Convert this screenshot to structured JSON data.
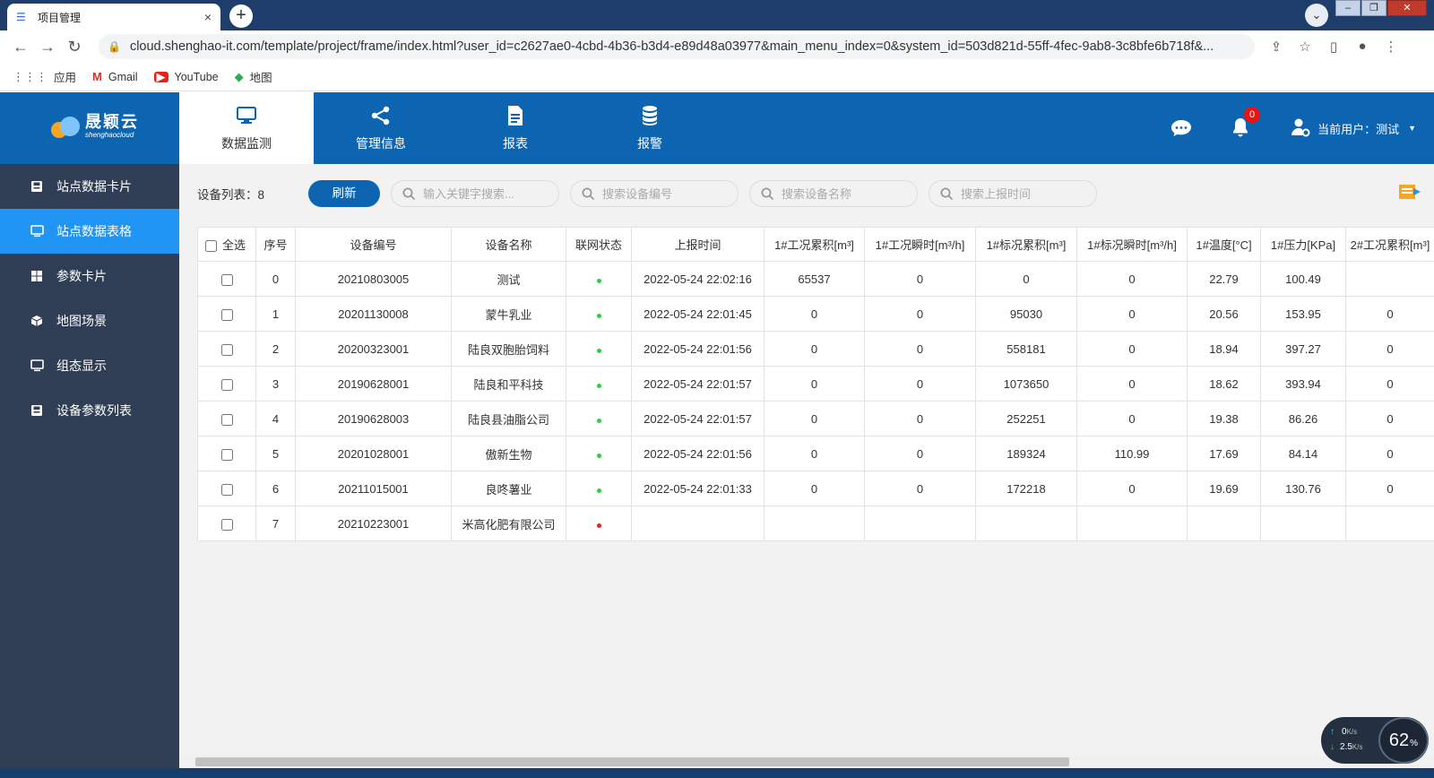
{
  "browser": {
    "tab_title": "项目管理",
    "tab_close": "×",
    "new_tab": "+",
    "url": "cloud.shenghao-it.com/template/project/frame/index.html?user_id=c2627ae0-4cbd-4b36-b3d4-e89d48a03977&main_menu_index=0&system_id=503d821d-55ff-4fec-9ab8-3c8bfe6b718f&...",
    "bookmarks": [
      {
        "label": "应用",
        "icon": "apps-grid-icon"
      },
      {
        "label": "Gmail",
        "icon": "gmail-icon"
      },
      {
        "label": "YouTube",
        "icon": "youtube-icon"
      },
      {
        "label": "地图",
        "icon": "maps-icon"
      }
    ]
  },
  "header": {
    "logo_text": "晟颖云",
    "logo_sub": "shenghaocloud",
    "nav": [
      {
        "label": "数据监测",
        "icon": "monitor-icon",
        "active": true
      },
      {
        "label": "管理信息",
        "icon": "share-nodes-icon",
        "active": false
      },
      {
        "label": "报表",
        "icon": "document-icon",
        "active": false
      },
      {
        "label": "报警",
        "icon": "database-icon",
        "active": false
      }
    ],
    "notification_count": "0",
    "current_user": "当前用户：测试"
  },
  "sidebar": {
    "items": [
      {
        "label": "站点数据卡片",
        "icon": "save-disk-icon",
        "active": false
      },
      {
        "label": "站点数据表格",
        "icon": "monitor-icon",
        "active": true
      },
      {
        "label": "参数卡片",
        "icon": "grid-icon",
        "active": false
      },
      {
        "label": "地图场景",
        "icon": "cube-icon",
        "active": false
      },
      {
        "label": "组态显示",
        "icon": "monitor-icon",
        "active": false
      },
      {
        "label": "设备参数列表",
        "icon": "save-disk-icon",
        "active": false
      }
    ]
  },
  "toolbar": {
    "device_count": "设备列表：8",
    "refresh_label": "刷新",
    "search_keyword_placeholder": "输入关键字搜索...",
    "search_code_placeholder": "搜索设备编号",
    "search_name_placeholder": "搜索设备名称",
    "search_time_placeholder": "搜索上报时间"
  },
  "table": {
    "select_all_label": "全选",
    "columns": [
      "序号",
      "设备编号",
      "设备名称",
      "联网状态",
      "上报时间",
      "1#工况累积[m³]",
      "1#工况瞬时[m³/h]",
      "1#标况累积[m³]",
      "1#标况瞬时[m³/h]",
      "1#温度[°C]",
      "1#压力[KPa]",
      "2#工况累积[m³]"
    ],
    "rows": [
      {
        "no": "0",
        "code": "20210803005",
        "name": "测试",
        "status": "online",
        "time": "2022-05-24 22:02:16",
        "c1": "65537",
        "c2": "0",
        "c3": "0",
        "c4": "0",
        "temp": "22.79",
        "press": "100.49",
        "c5": ""
      },
      {
        "no": "1",
        "code": "20201130008",
        "name": "蒙牛乳业",
        "status": "online",
        "time": "2022-05-24 22:01:45",
        "c1": "0",
        "c2": "0",
        "c3": "95030",
        "c4": "0",
        "temp": "20.56",
        "press": "153.95",
        "c5": "0"
      },
      {
        "no": "2",
        "code": "20200323001",
        "name": "陆良双胞胎饲料",
        "status": "online",
        "time": "2022-05-24 22:01:56",
        "c1": "0",
        "c2": "0",
        "c3": "558181",
        "c4": "0",
        "temp": "18.94",
        "press": "397.27",
        "c5": "0"
      },
      {
        "no": "3",
        "code": "20190628001",
        "name": "陆良和平科技",
        "status": "online",
        "time": "2022-05-24 22:01:57",
        "c1": "0",
        "c2": "0",
        "c3": "1073650",
        "c4": "0",
        "temp": "18.62",
        "press": "393.94",
        "c5": "0"
      },
      {
        "no": "4",
        "code": "20190628003",
        "name": "陆良县油脂公司",
        "status": "online",
        "time": "2022-05-24 22:01:57",
        "c1": "0",
        "c2": "0",
        "c3": "252251",
        "c4": "0",
        "temp": "19.38",
        "press": "86.26",
        "c5": "0"
      },
      {
        "no": "5",
        "code": "20201028001",
        "name": "傲新生物",
        "status": "online",
        "time": "2022-05-24 22:01:56",
        "c1": "0",
        "c2": "0",
        "c3": "189324",
        "c4": "110.99",
        "temp": "17.69",
        "press": "84.14",
        "c5": "0"
      },
      {
        "no": "6",
        "code": "20211015001",
        "name": "良咚薯业",
        "status": "online",
        "time": "2022-05-24 22:01:33",
        "c1": "0",
        "c2": "0",
        "c3": "172218",
        "c4": "0",
        "temp": "19.69",
        "press": "130.76",
        "c5": "0"
      },
      {
        "no": "7",
        "code": "20210223001",
        "name": "米高化肥有限公司",
        "status": "offline",
        "time": "",
        "c1": "",
        "c2": "",
        "c3": "",
        "c4": "",
        "temp": "",
        "press": "",
        "c5": ""
      }
    ]
  },
  "status_colors": {
    "online": "#2ecc40",
    "offline": "#e0202a"
  },
  "colors": {
    "brand": "#0d65b2",
    "sidebar_bg": "#2f3e54",
    "sidebar_active": "#2195f3"
  },
  "net_widget": {
    "upload": "0",
    "upload_unit": "K/s",
    "download": "2.5",
    "download_unit": "K/s",
    "cpu": "62",
    "cpu_unit": "%"
  }
}
